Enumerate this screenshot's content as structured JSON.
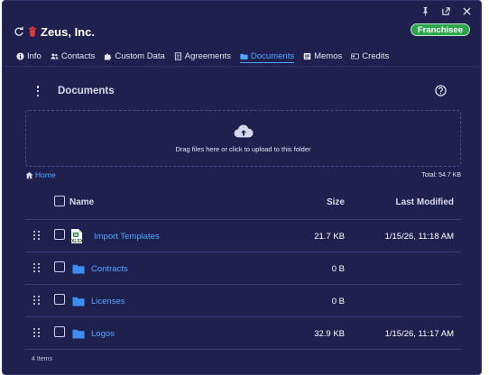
{
  "window": {
    "controls": [
      {
        "name": "pin-icon"
      },
      {
        "name": "external-link-icon"
      },
      {
        "name": "close-icon"
      }
    ]
  },
  "header": {
    "title": "Zeus, Inc.",
    "badge": "Franchisee",
    "badge_color": "#2fa64e"
  },
  "tabs": [
    {
      "label": "Info",
      "icon": "info-icon",
      "active": false
    },
    {
      "label": "Contacts",
      "icon": "contacts-icon",
      "active": false
    },
    {
      "label": "Custom Data",
      "icon": "puzzle-icon",
      "active": false
    },
    {
      "label": "Agreements",
      "icon": "agreement-icon",
      "active": false
    },
    {
      "label": "Documents",
      "icon": "folder-icon",
      "active": true
    },
    {
      "label": "Memos",
      "icon": "memo-icon",
      "active": false
    },
    {
      "label": "Credits",
      "icon": "credits-icon",
      "active": false
    }
  ],
  "documents": {
    "title": "Documents",
    "dropzone_hint": "Drag files here or click to upload to this folder",
    "breadcrumb": "Home",
    "total": "Total: 54.7 KB",
    "columns": {
      "name": "Name",
      "size": "Size",
      "modified": "Last Modified"
    },
    "rows": [
      {
        "type": "file",
        "icon": "xlsx-file-icon",
        "icon_label": "XLSX",
        "name": "Import Templates",
        "size": "21.7 KB",
        "modified": "1/15/26, 11:18 AM"
      },
      {
        "type": "folder",
        "icon": "folder-icon",
        "name": "Contracts",
        "size": "0 B",
        "modified": ""
      },
      {
        "type": "folder",
        "icon": "folder-icon",
        "name": "Licenses",
        "size": "0 B",
        "modified": ""
      },
      {
        "type": "folder",
        "icon": "folder-icon",
        "name": "Logos",
        "size": "32.9 KB",
        "modified": "1/15/26, 11:17 AM"
      }
    ],
    "item_count": "4 Items"
  },
  "colors": {
    "panel_bg": "#20204f",
    "accent": "#4fa7ff",
    "badge": "#2fa64e",
    "trash": "#e53935"
  }
}
